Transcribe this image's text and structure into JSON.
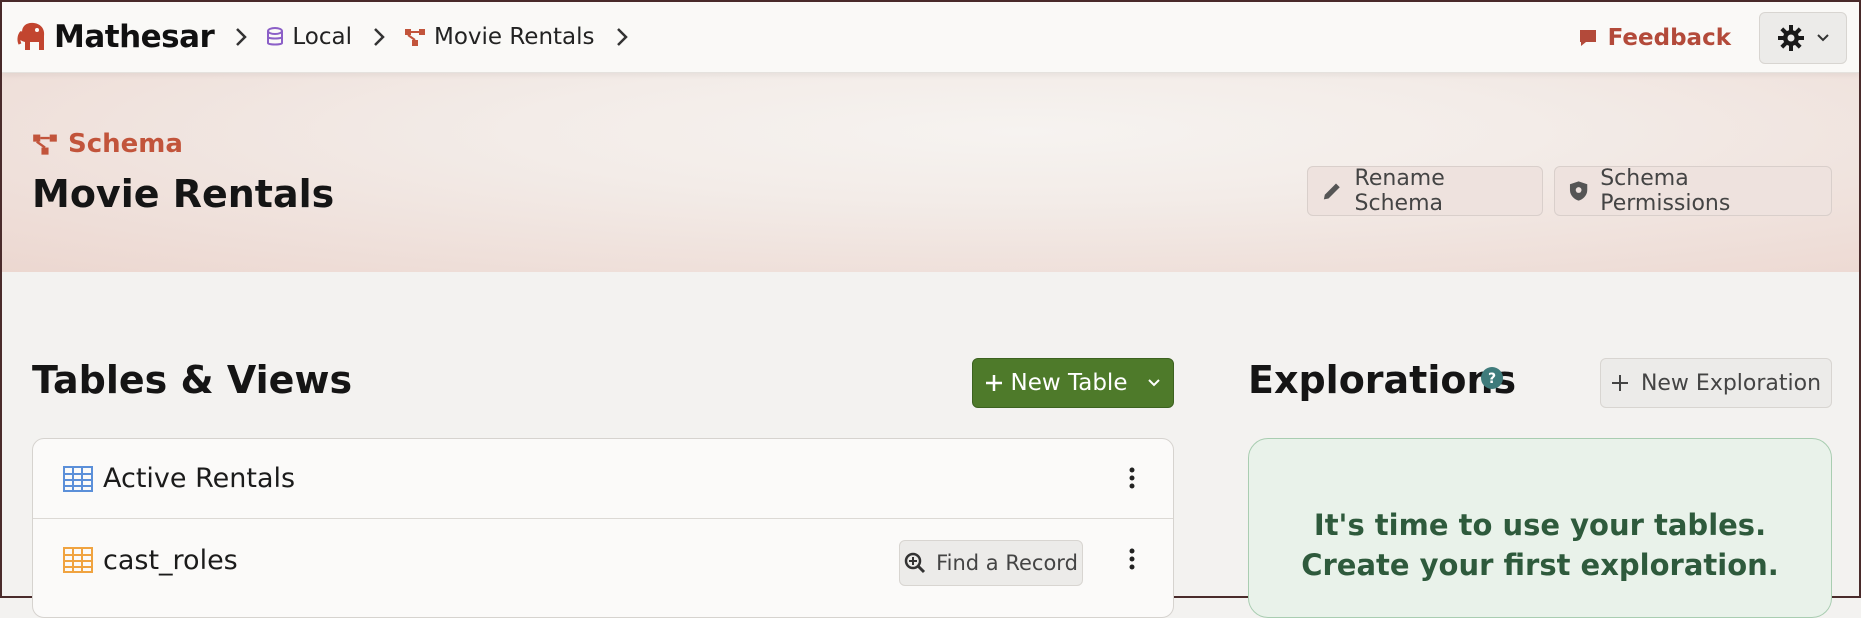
{
  "app": {
    "name": "Mathesar"
  },
  "breadcrumbs": [
    {
      "label": "Local",
      "icon": "database-icon"
    },
    {
      "label": "Movie Rentals",
      "icon": "schema-icon"
    }
  ],
  "topbar": {
    "feedback_label": "Feedback"
  },
  "header": {
    "kind_label": "Schema",
    "title": "Movie Rentals",
    "rename_label": "Rename Schema",
    "permissions_label": "Schema Permissions"
  },
  "tables_section": {
    "title": "Tables & Views",
    "new_table_label": "New Table",
    "items": [
      {
        "name": "Active Rentals",
        "kind": "view",
        "icon_color": "#5b8fd9"
      },
      {
        "name": "cast_roles",
        "kind": "table",
        "icon_color": "#f0a340",
        "find_label": "Find a Record"
      }
    ]
  },
  "explorations_section": {
    "title": "Explorations",
    "new_label": "New Exploration",
    "empty_message": "It's time to use your tables. Create your first exploration."
  },
  "colors": {
    "brand": "#c2543b",
    "primary_button": "#4e7a2a",
    "feedback": "#b34a3a"
  }
}
